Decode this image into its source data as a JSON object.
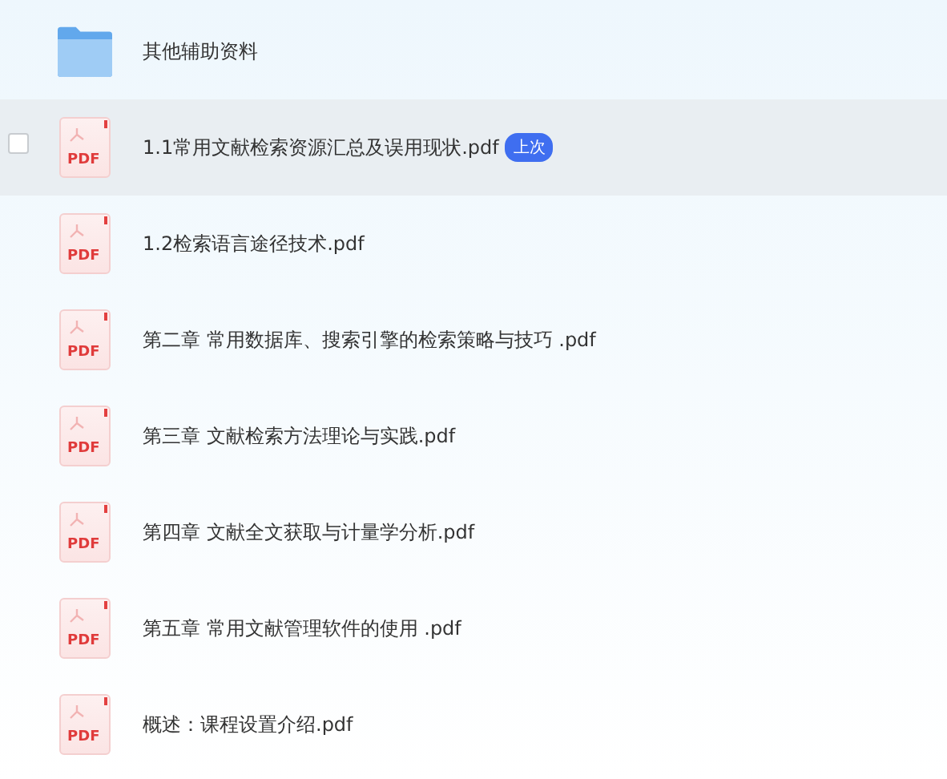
{
  "files": [
    {
      "kind": "folder",
      "name": "其他辅助资料",
      "highlighted": false
    },
    {
      "kind": "pdf",
      "icon_label": "PDF",
      "name": "1.1常用文献检索资源汇总及误用现状.pdf",
      "highlighted": true,
      "checkbox": {
        "checked": false
      },
      "badge": "上次"
    },
    {
      "kind": "pdf",
      "icon_label": "PDF",
      "name": "1.2检索语言途径技术.pdf",
      "highlighted": false
    },
    {
      "kind": "pdf",
      "icon_label": "PDF",
      "name": "第二章 常用数据库、搜索引擎的检索策略与技巧 .pdf",
      "highlighted": false
    },
    {
      "kind": "pdf",
      "icon_label": "PDF",
      "name": "第三章 文献检索方法理论与实践.pdf",
      "highlighted": false
    },
    {
      "kind": "pdf",
      "icon_label": "PDF",
      "name": "第四章 文献全文获取与计量学分析.pdf",
      "highlighted": false
    },
    {
      "kind": "pdf",
      "icon_label": "PDF",
      "name": "第五章 常用文献管理软件的使用 .pdf",
      "highlighted": false
    },
    {
      "kind": "pdf",
      "icon_label": "PDF",
      "name": "概述：课程设置介绍.pdf",
      "highlighted": false
    }
  ]
}
